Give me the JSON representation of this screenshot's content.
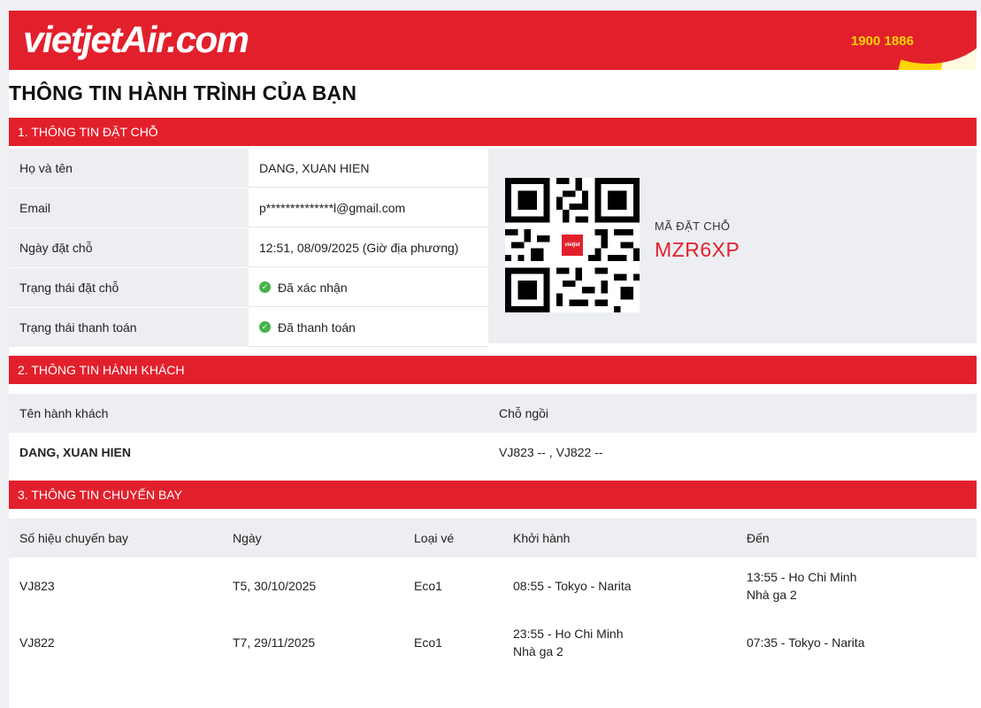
{
  "header": {
    "logo": "vietjetAir.com",
    "hotline": "1900 1886",
    "colors": {
      "brand_red": "#e2202c",
      "brand_yellow": "#ffd400"
    }
  },
  "page_title": "THÔNG TIN HÀNH TRÌNH CỦA BẠN",
  "booking": {
    "section_title": "1. THÔNG TIN ĐẶT CHỖ",
    "rows": [
      {
        "label": "Họ và tên",
        "value": "DANG, XUAN HIEN"
      },
      {
        "label": "Email",
        "value": "p**************l@gmail.com"
      },
      {
        "label": "Ngày đặt chỗ",
        "value": "12:51, 08/09/2025 (Giờ địa phương)"
      },
      {
        "label": "Trạng thái đặt chỗ",
        "value": "Đã xác nhận",
        "icon": "check-circle-icon"
      },
      {
        "label": "Trạng thái thanh toán",
        "value": "Đã thanh toán",
        "icon": "check-circle-icon"
      }
    ],
    "pnr_label": "MÃ ĐẶT CHỖ",
    "pnr_code": "MZR6XP"
  },
  "passengers": {
    "section_title": "2. THÔNG TIN HÀNH KHÁCH",
    "headers": {
      "name": "Tên hành khách",
      "seat": "Chỗ ngồi"
    },
    "rows": [
      {
        "name": "DANG, XUAN HIEN",
        "seat": "VJ823 -- , VJ822 --"
      }
    ]
  },
  "flights": {
    "section_title": "3. THÔNG TIN CHUYẾN BAY",
    "headers": {
      "flight_no": "Số hiệu chuyến bay",
      "date": "Ngày",
      "fare": "Loại vé",
      "depart": "Khởi hành",
      "arrive": "Đến"
    },
    "rows": [
      {
        "flight_no": "VJ823",
        "date": "T5, 30/10/2025",
        "fare": "Eco1",
        "depart": "08:55 - Tokyo - Narita",
        "depart_terminal": "",
        "arrive": "13:55 - Ho Chi Minh",
        "arrive_terminal": "Nhà ga 2"
      },
      {
        "flight_no": "VJ822",
        "date": "T7, 29/11/2025",
        "fare": "Eco1",
        "depart": "23:55 - Ho Chi Minh",
        "depart_terminal": "Nhà ga 2",
        "arrive": "07:35 - Tokyo - Narita",
        "arrive_terminal": ""
      }
    ]
  }
}
